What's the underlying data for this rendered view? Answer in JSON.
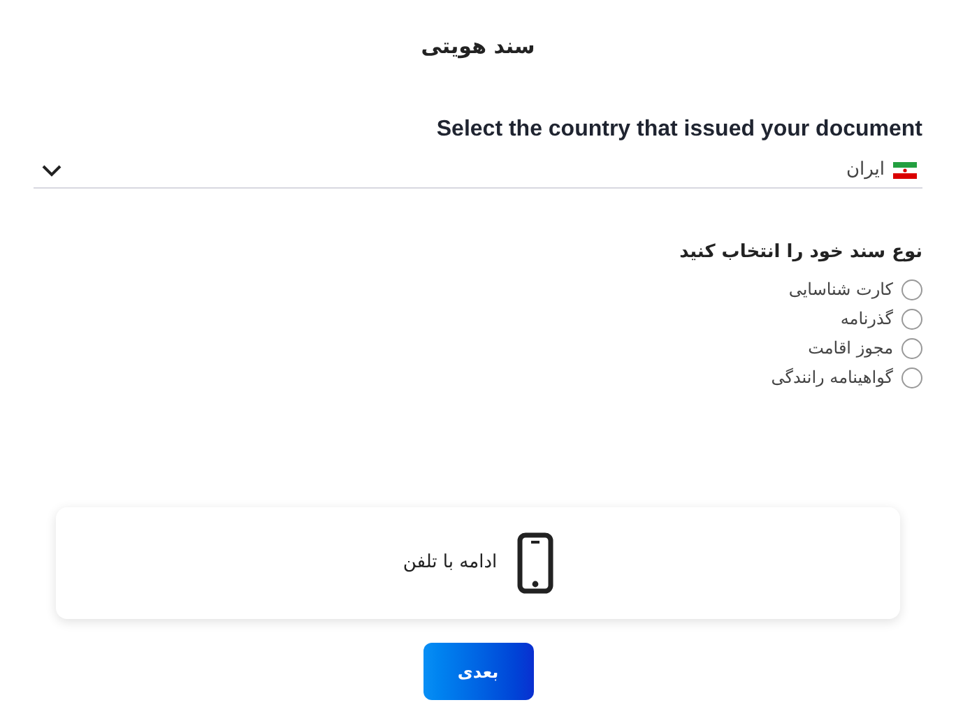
{
  "title": "سند هویتی",
  "country": {
    "label": "Select the country that issued your document",
    "value": "ایران"
  },
  "document_type": {
    "label": "نوع سند خود را انتخاب کنید",
    "options": [
      {
        "label": "کارت شناسایی",
        "selected": false
      },
      {
        "label": "گذرنامه",
        "selected": false
      },
      {
        "label": "مجوز اقامت",
        "selected": false
      },
      {
        "label": "گواهینامه رانندگی",
        "selected": false
      }
    ]
  },
  "phone_card": {
    "label": "ادامه با تلفن"
  },
  "next_button": {
    "label": "بعدی"
  }
}
